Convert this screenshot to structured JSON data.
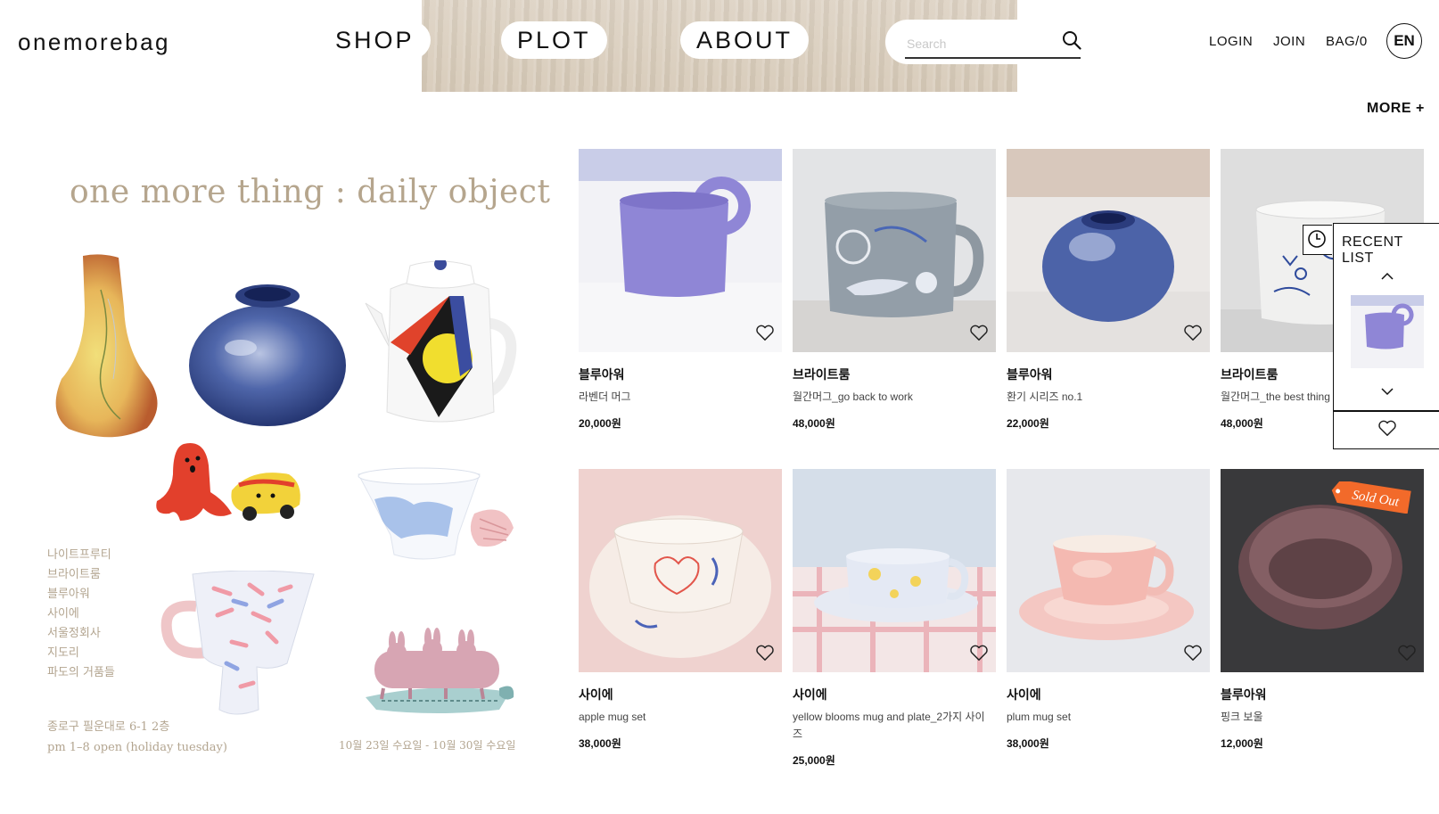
{
  "header": {
    "logo": "onemorebag",
    "nav": [
      "SHOP",
      "PLOT",
      "ABOUT"
    ],
    "search": {
      "placeholder": "Search"
    },
    "util": {
      "login": "LOGIN",
      "join": "JOIN",
      "bag": "BAG/0"
    },
    "lang": "EN",
    "more": "MORE +"
  },
  "poster": {
    "title": "one more thing : daily object",
    "artists": [
      "나이트프루티",
      "브라이트룸",
      "블루아워",
      "사이에",
      "서울정회사",
      "지도리",
      "파도의 거품들"
    ],
    "address": "종로구 필운대로 6-1 2층",
    "hours": "pm 1–8 open (holiday tuesday)",
    "dates": "10월 23일 수요일 - 10월 30일 수요일"
  },
  "products": [
    {
      "brand": "블루아워",
      "name": "라벤더 머그",
      "price": "20,000원"
    },
    {
      "brand": "브라이트룸",
      "name": "월간머그_go back to work",
      "price": "48,000원"
    },
    {
      "brand": "블루아워",
      "name": "환기 시리즈 no.1",
      "price": "22,000원"
    },
    {
      "brand": "브라이트룸",
      "name": "월간머그_the best thing",
      "price": "48,000원"
    },
    {
      "brand": "사이에",
      "name": "apple mug set",
      "price": "38,000원"
    },
    {
      "brand": "사이에",
      "name": "yellow blooms mug and plate_2가지 사이즈",
      "price": "25,000원"
    },
    {
      "brand": "사이에",
      "name": "plum mug set",
      "price": "38,000원"
    },
    {
      "brand": "블루아워",
      "name": "핑크 보울",
      "price": "12,000원",
      "badge": "Sold Out"
    }
  ],
  "recent": {
    "label": "RECENT LIST"
  },
  "colors": {
    "accent_badge": "#f26a2a",
    "poster_text": "#b5a58d",
    "lavender": "#8f86d6"
  }
}
